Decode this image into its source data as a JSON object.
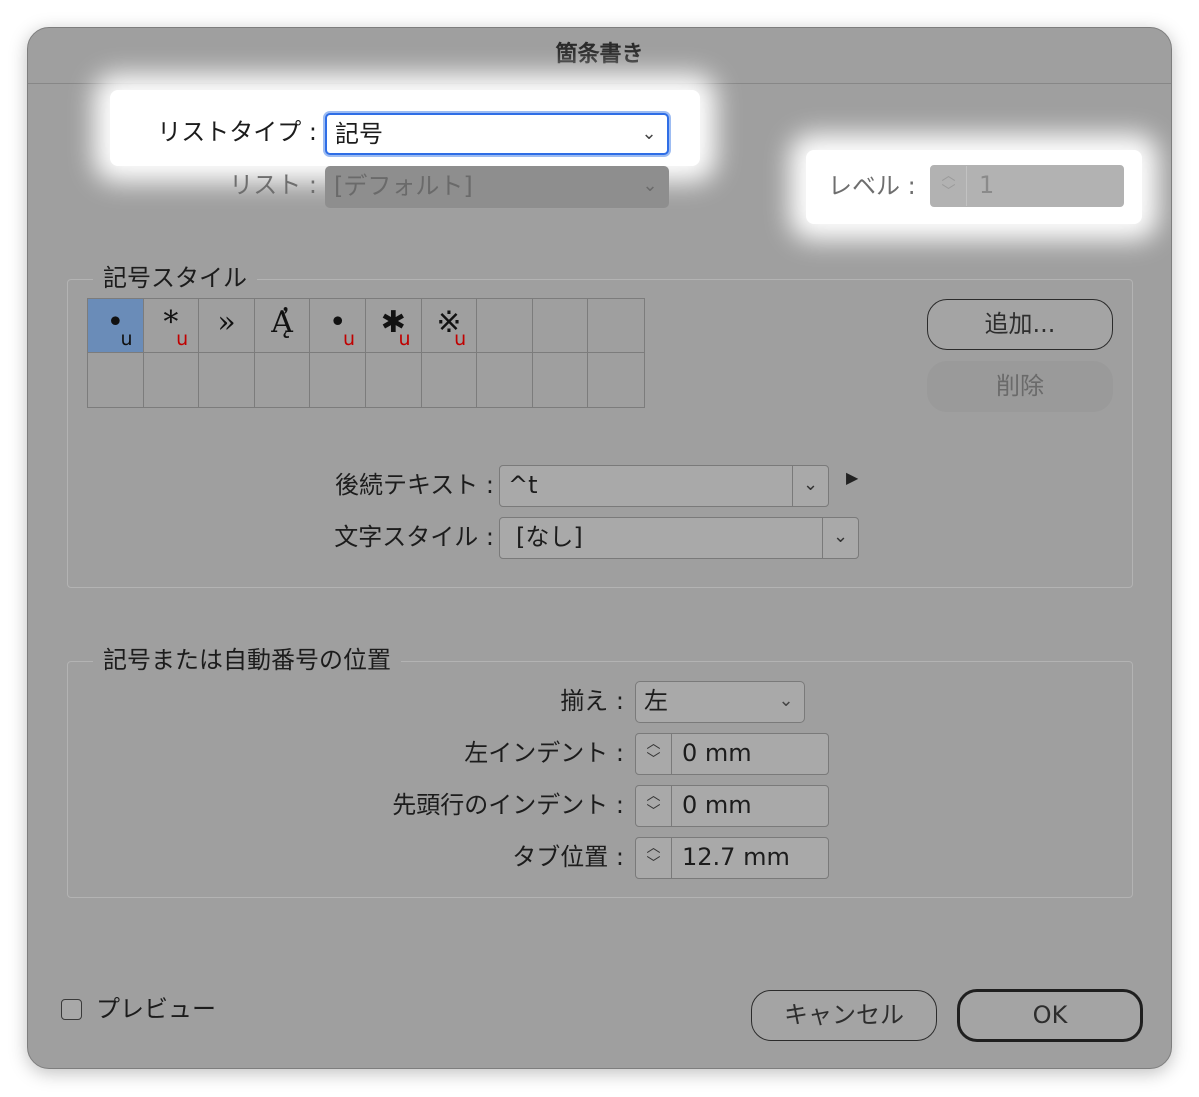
{
  "window": {
    "title": "箇条書き"
  },
  "list_type": {
    "label": "リストタイプ :",
    "value": "記号"
  },
  "list": {
    "label": "リスト :",
    "value": "[デフォルト]"
  },
  "level": {
    "label": "レベル :",
    "value": "1"
  },
  "bullet_style": {
    "legend": "記号スタイル",
    "glyphs": [
      {
        "char": "•",
        "mark": "u",
        "selected": true
      },
      {
        "char": "*",
        "mark": "u"
      },
      {
        "char": "»",
        "mark": ""
      },
      {
        "char": "Ą̓",
        "mark": ""
      },
      {
        "char": "•",
        "mark": "u"
      },
      {
        "char": "✱",
        "mark": "u"
      },
      {
        "char": "※",
        "mark": "u"
      }
    ],
    "add_label": "追加...",
    "delete_label": "削除",
    "text_after": {
      "label": "後続テキスト :",
      "value": "^t"
    },
    "char_style": {
      "label": "文字スタイル :",
      "value": "[なし]"
    }
  },
  "position": {
    "legend": "記号または自動番号の位置",
    "alignment": {
      "label": "揃え :",
      "value": "左"
    },
    "left_indent": {
      "label": "左インデント :",
      "value": "0 mm"
    },
    "first_line_indent": {
      "label": "先頭行のインデント :",
      "value": "0 mm"
    },
    "tab_position": {
      "label": "タブ位置 :",
      "value": "12.7 mm"
    }
  },
  "footer": {
    "preview_label": "プレビュー",
    "cancel_label": "キャンセル",
    "ok_label": "OK"
  }
}
